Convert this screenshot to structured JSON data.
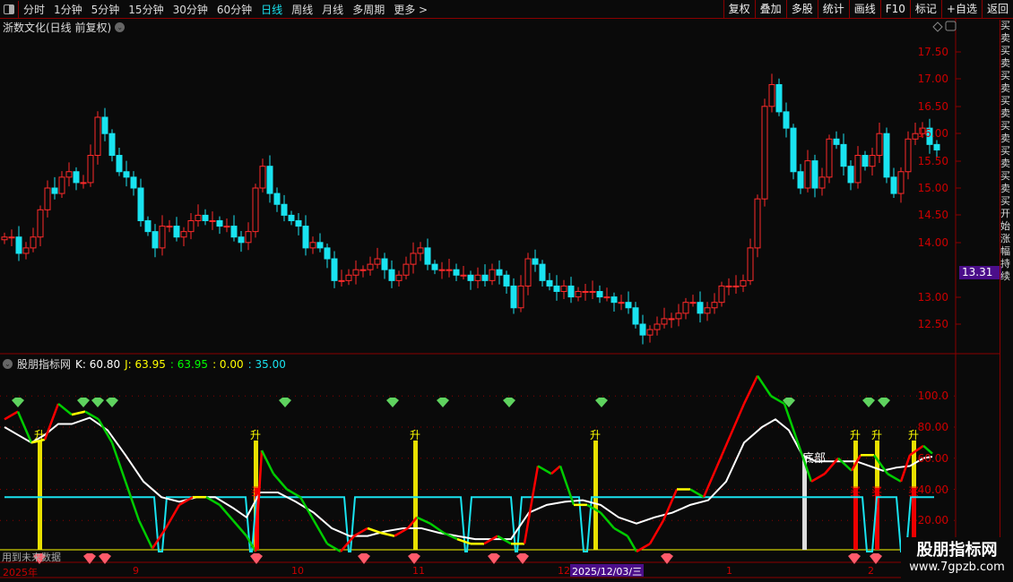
{
  "toolbar": {
    "tabs": [
      "分时",
      "1分钟",
      "5分钟",
      "15分钟",
      "30分钟",
      "60分钟",
      "日线",
      "周线",
      "月线",
      "多周期",
      "更多 >"
    ],
    "active": "日线",
    "right": [
      "复权",
      "叠加",
      "多股",
      "统计",
      "画线",
      "F10",
      "标记",
      "+自选",
      "返回"
    ]
  },
  "stock_title": "浙数文化(日线 前复权)",
  "price_axis": [
    "17.50",
    "17.00",
    "16.50",
    "16.00",
    "15.50",
    "15.00",
    "14.50",
    "14.00",
    "13.00",
    "12.50"
  ],
  "current_price": "13.31",
  "indicator": {
    "name": "股朋指标网",
    "k": "K: 60.80",
    "j": "J: 63.95",
    "v2": ": 63.95",
    "v3": ": 0.00",
    "v4": ": 35.00",
    "axis": [
      "100.0",
      "80.00",
      "60.00",
      "40.00",
      "20.00"
    ],
    "rise_label": "升",
    "bottom_label": "底部",
    "buy_label": "买"
  },
  "no_future": "用到未来数据",
  "x_labels": [
    "2025年",
    "9",
    "10",
    "11",
    "12",
    "1",
    "2"
  ],
  "cursor_date": "2025/12/03/三",
  "side_text": "买卖买卖买卖买卖买卖买卖买卖买开始涨幅持续",
  "watermark": {
    "name": "股朋指标网",
    "url": "www.7gpzb.com"
  },
  "colors": {
    "up": "#ff2a2a",
    "down": "#19e3f0",
    "grid": "#8b0000"
  },
  "chart_data": {
    "type": "candlestick",
    "closes": [
      14.1,
      14.1,
      13.8,
      13.9,
      14.1,
      14.6,
      15.0,
      14.9,
      15.2,
      15.3,
      15.1,
      15.1,
      15.6,
      16.3,
      16.0,
      15.6,
      15.3,
      15.2,
      15.0,
      14.4,
      14.2,
      13.9,
      14.3,
      14.3,
      14.1,
      14.2,
      14.4,
      14.5,
      14.4,
      14.4,
      14.3,
      14.3,
      14.1,
      14.0,
      14.2,
      15.0,
      15.4,
      14.9,
      14.7,
      14.5,
      14.4,
      14.3,
      13.9,
      14.0,
      13.9,
      13.7,
      13.3,
      13.3,
      13.4,
      13.5,
      13.5,
      13.6,
      13.7,
      13.5,
      13.3,
      13.4,
      13.6,
      13.8,
      13.9,
      13.6,
      13.5,
      13.5,
      13.5,
      13.4,
      13.4,
      13.3,
      13.4,
      13.3,
      13.5,
      13.4,
      13.2,
      12.8,
      13.2,
      13.7,
      13.6,
      13.3,
      13.2,
      13.1,
      13.2,
      13.0,
      13.1,
      13.1,
      13.1,
      13.0,
      13.0,
      12.9,
      12.9,
      12.8,
      12.5,
      12.3,
      12.4,
      12.5,
      12.6,
      12.6,
      12.7,
      12.9,
      12.9,
      12.7,
      12.8,
      12.9,
      13.2,
      13.2,
      13.2,
      13.3,
      13.9,
      14.8,
      16.5,
      16.9,
      16.4,
      16.1,
      15.3,
      15.0,
      15.5,
      15.0,
      15.2,
      15.9,
      15.8,
      15.4,
      15.1,
      15.6,
      15.4,
      15.6,
      16.0,
      15.2,
      14.9,
      15.3,
      15.9,
      16.0,
      16.1,
      15.8,
      15.7
    ],
    "ylim": [
      12.0,
      18.0
    ],
    "indicator_j": [
      [
        5,
        85
      ],
      [
        20,
        90
      ],
      [
        35,
        70
      ],
      [
        50,
        72
      ],
      [
        65,
        95
      ],
      [
        80,
        88
      ],
      [
        95,
        90
      ],
      [
        110,
        85
      ],
      [
        125,
        70
      ],
      [
        140,
        45
      ],
      [
        155,
        20
      ],
      [
        170,
        2
      ],
      [
        185,
        15
      ],
      [
        200,
        30
      ],
      [
        215,
        35
      ],
      [
        230,
        35
      ],
      [
        245,
        30
      ],
      [
        260,
        20
      ],
      [
        275,
        10
      ],
      [
        285,
        0
      ],
      [
        292,
        65
      ],
      [
        305,
        50
      ],
      [
        320,
        40
      ],
      [
        335,
        35
      ],
      [
        350,
        20
      ],
      [
        365,
        5
      ],
      [
        380,
        0
      ],
      [
        395,
        10
      ],
      [
        410,
        15
      ],
      [
        425,
        12
      ],
      [
        440,
        10
      ],
      [
        455,
        15
      ],
      [
        465,
        22
      ],
      [
        480,
        18
      ],
      [
        495,
        12
      ],
      [
        510,
        8
      ],
      [
        525,
        5
      ],
      [
        540,
        5
      ],
      [
        555,
        10
      ],
      [
        570,
        5
      ],
      [
        585,
        5
      ],
      [
        600,
        55
      ],
      [
        615,
        50
      ],
      [
        625,
        55
      ],
      [
        640,
        30
      ],
      [
        655,
        30
      ],
      [
        670,
        25
      ],
      [
        685,
        15
      ],
      [
        700,
        10
      ],
      [
        710,
        0
      ],
      [
        725,
        5
      ],
      [
        740,
        20
      ],
      [
        755,
        40
      ],
      [
        770,
        40
      ],
      [
        785,
        35
      ],
      [
        800,
        55
      ],
      [
        815,
        75
      ],
      [
        830,
        95
      ],
      [
        845,
        113
      ],
      [
        860,
        100
      ],
      [
        875,
        95
      ],
      [
        890,
        70
      ],
      [
        905,
        45
      ],
      [
        920,
        50
      ],
      [
        935,
        60
      ],
      [
        950,
        52
      ],
      [
        960,
        62
      ],
      [
        975,
        62
      ],
      [
        990,
        50
      ],
      [
        1005,
        45
      ],
      [
        1015,
        62
      ],
      [
        1030,
        68
      ],
      [
        1040,
        63
      ]
    ],
    "indicator_k": [
      [
        5,
        80
      ],
      [
        20,
        75
      ],
      [
        35,
        70
      ],
      [
        50,
        75
      ],
      [
        65,
        82
      ],
      [
        80,
        82
      ],
      [
        100,
        86
      ],
      [
        120,
        78
      ],
      [
        140,
        62
      ],
      [
        160,
        45
      ],
      [
        180,
        35
      ],
      [
        200,
        32
      ],
      [
        220,
        35
      ],
      [
        240,
        35
      ],
      [
        260,
        28
      ],
      [
        275,
        22
      ],
      [
        290,
        38
      ],
      [
        310,
        38
      ],
      [
        330,
        32
      ],
      [
        350,
        25
      ],
      [
        370,
        15
      ],
      [
        390,
        10
      ],
      [
        410,
        10
      ],
      [
        430,
        13
      ],
      [
        450,
        15
      ],
      [
        470,
        15
      ],
      [
        490,
        12
      ],
      [
        510,
        10
      ],
      [
        530,
        8
      ],
      [
        550,
        8
      ],
      [
        570,
        8
      ],
      [
        590,
        25
      ],
      [
        610,
        30
      ],
      [
        630,
        32
      ],
      [
        650,
        33
      ],
      [
        670,
        30
      ],
      [
        690,
        22
      ],
      [
        710,
        18
      ],
      [
        730,
        22
      ],
      [
        750,
        25
      ],
      [
        770,
        30
      ],
      [
        790,
        33
      ],
      [
        810,
        45
      ],
      [
        830,
        70
      ],
      [
        850,
        80
      ],
      [
        865,
        85
      ],
      [
        880,
        78
      ],
      [
        895,
        62
      ],
      [
        910,
        58
      ],
      [
        925,
        58
      ],
      [
        940,
        58
      ],
      [
        955,
        58
      ],
      [
        970,
        55
      ],
      [
        985,
        52
      ],
      [
        1000,
        54
      ],
      [
        1015,
        55
      ],
      [
        1030,
        60
      ],
      [
        1040,
        61
      ]
    ],
    "cyan_dips": [
      [
        172,
        186
      ],
      [
        274,
        286
      ],
      [
        384,
        396
      ],
      [
        514,
        526
      ],
      [
        570,
        582
      ],
      [
        646,
        660
      ],
      [
        962,
        978
      ],
      [
        1000,
        1016
      ]
    ],
    "rise_signals": [
      44,
      285,
      463,
      664,
      954,
      978,
      1019
    ],
    "buy_signals": [
      286,
      954,
      978,
      1019
    ],
    "bottom_signal": 897,
    "green_gems": [
      20,
      93,
      109,
      125,
      318,
      438,
      494,
      568,
      671,
      880,
      969,
      986
    ],
    "red_gems": [
      44,
      100,
      117,
      286,
      406,
      462,
      551,
      583,
      744,
      953,
      977
    ]
  }
}
